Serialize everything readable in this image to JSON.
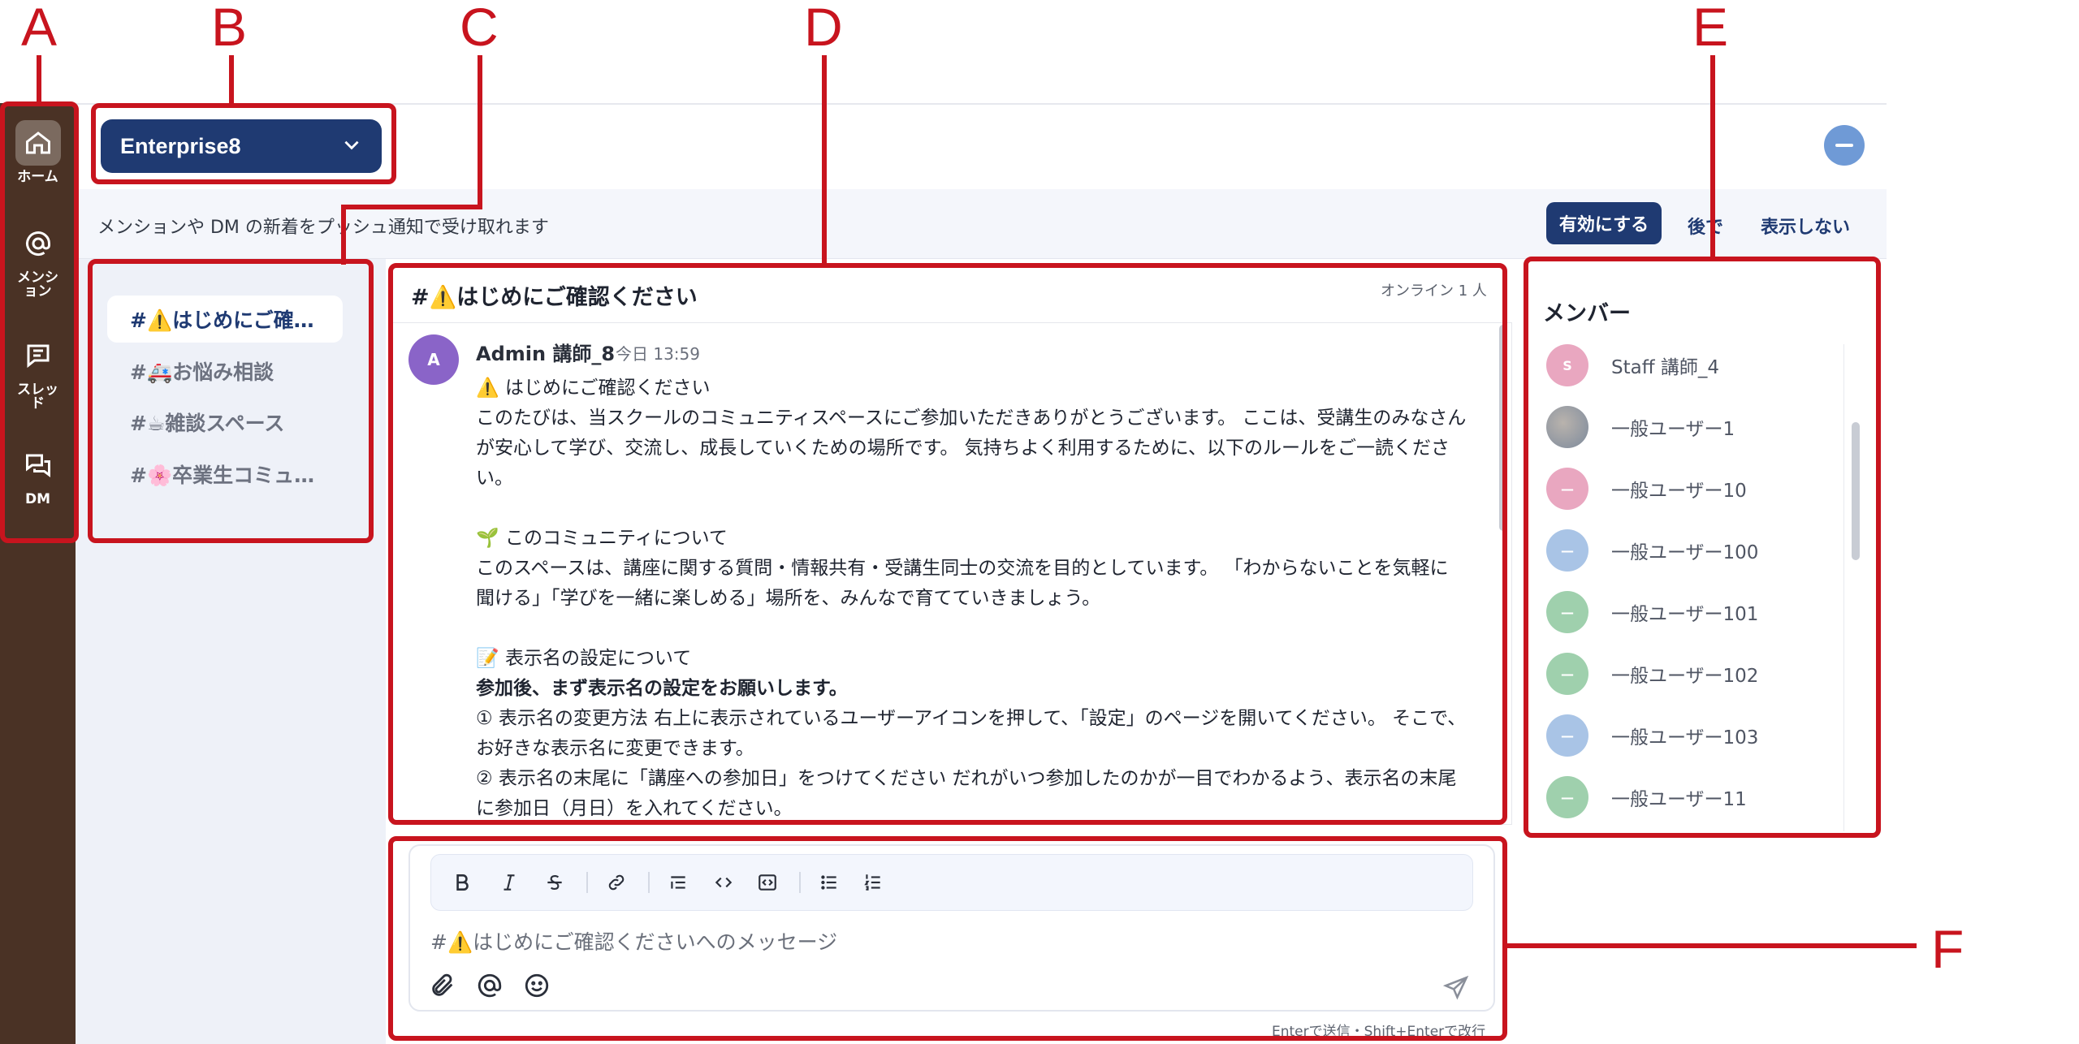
{
  "annotations": [
    "A",
    "B",
    "C",
    "D",
    "E",
    "F"
  ],
  "rail": {
    "items": [
      {
        "label": "ホーム",
        "icon": "home-icon"
      },
      {
        "label": "メンション",
        "icon": "at-icon"
      },
      {
        "label": "スレッド",
        "icon": "thread-icon"
      },
      {
        "label": "DM",
        "icon": "dm-icon"
      }
    ]
  },
  "workspace": {
    "name": "Enterprise8"
  },
  "banner": {
    "text": "メンションや DM の新着をプッシュ通知で受け取れます",
    "enable_label": "有効にする",
    "later_label": "後で",
    "never_label": "表示しない"
  },
  "channels": [
    {
      "label": "#⚠️はじめにご確…",
      "active": true
    },
    {
      "label": "#🚑お悩み相談",
      "active": false
    },
    {
      "label": "#☕雑談スペース",
      "active": false
    },
    {
      "label": "#🌸卒業生コミュ…",
      "active": false
    }
  ],
  "chat": {
    "title": "#⚠️はじめにご確認ください",
    "online": "オンライン 1 人",
    "message": {
      "avatar_initial": "A",
      "author": "Admin 講師_8",
      "time": "今日 13:59",
      "lines": [
        "⚠️ はじめにご確認ください",
        "このたびは、当スクールのコミュニティスペースにご参加いただきありがとうございます。 ここは、受講生のみなさんが安心して学び、交流し、成長していくための場所です。 気持ちよく利用するために、以下のルールをご一読ください。",
        "",
        "🌱 このコミュニティについて",
        "このスペースは、講座に関する質問・情報共有・受講生同士の交流を目的としています。 「わからないことを気軽に聞ける」「学びを一緒に楽しめる」場所を、みんなで育てていきましょう。",
        "",
        "📝 表示名の設定について",
        "参加後、まず表示名の設定をお願いします。",
        "① 表示名の変更方法 右上に表示されているユーザーアイコンを押して、「設定」のページを開いてください。 そこで、お好きな表示名に変更できます。",
        "② 表示名の末尾に「講座への参加日」をつけてください だれがいつ参加したのかが一目でわかるよう、表示名の末尾に参加日（月日）を入れてください。"
      ]
    }
  },
  "composer": {
    "placeholder": "#⚠️はじめにご確認くださいへのメッセージ",
    "hint": "Enterで送信・Shift+Enterで改行"
  },
  "members": {
    "title": "メンバー",
    "list": [
      {
        "name": "Staff 講師_4",
        "initial": "S",
        "color": "#e9a7c0"
      },
      {
        "name": "一般ユーザー1",
        "initial": "",
        "color": "#9aa6b4",
        "photo": true
      },
      {
        "name": "一般ユーザー10",
        "initial": "—",
        "color": "#e9a7c0"
      },
      {
        "name": "一般ユーザー100",
        "initial": "—",
        "color": "#a9c4e6"
      },
      {
        "name": "一般ユーザー101",
        "initial": "—",
        "color": "#9fd0ad"
      },
      {
        "name": "一般ユーザー102",
        "initial": "—",
        "color": "#9fd0ad"
      },
      {
        "name": "一般ユーザー103",
        "initial": "—",
        "color": "#a9c4e6"
      },
      {
        "name": "一般ユーザー11",
        "initial": "—",
        "color": "#9fd0ad"
      }
    ]
  },
  "colors": {
    "accent": "#1f3a72",
    "annotation": "#c8141e",
    "rail": "#4a3225"
  }
}
